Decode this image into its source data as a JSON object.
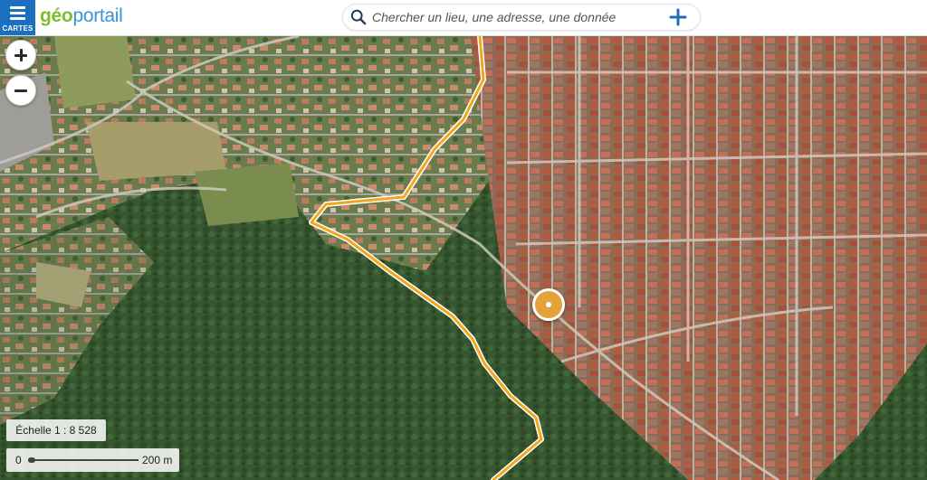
{
  "header": {
    "menu_label": "CARTES",
    "logo_part1": "géo",
    "logo_part2": "portail",
    "search_placeholder": "Chercher un lieu, une adresse, une donnée"
  },
  "map": {
    "zoom_in_label": "+",
    "zoom_out_label": "−",
    "scale_text": "Échelle 1 : 8 528",
    "scale_bar_zero": "0",
    "scale_bar_distance": "200 m",
    "route_color": "#f3a51b",
    "marker_color": "#e3a23a",
    "icons": [
      "menu-icon",
      "search-icon",
      "plus-icon",
      "location-marker-icon"
    ]
  }
}
